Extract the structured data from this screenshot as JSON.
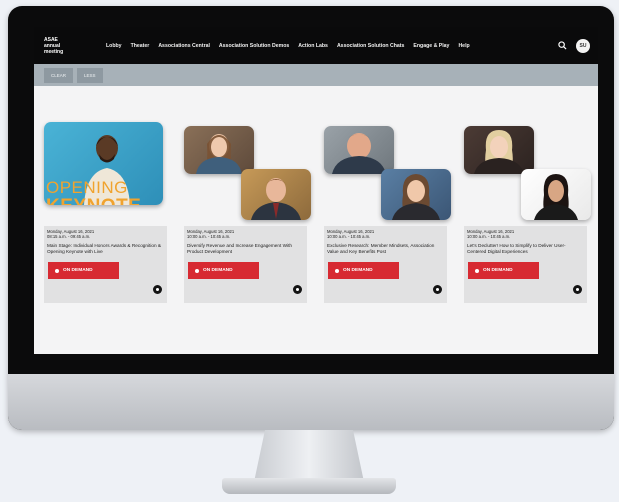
{
  "logo": {
    "line1": "ASAE",
    "line2": "annual",
    "line3": "meeting"
  },
  "nav": {
    "items": [
      {
        "label": "Lobby"
      },
      {
        "label": "Theater"
      },
      {
        "label": "Associations Central"
      },
      {
        "label": "Association Solution Demos"
      },
      {
        "label": "Action Labs"
      },
      {
        "label": "Association Solution Chats"
      },
      {
        "label": "Engage & Play"
      },
      {
        "label": "Help"
      }
    ],
    "avatar_initials": "SU"
  },
  "filters": [
    {
      "label": "CLEAR"
    },
    {
      "label": "LESS"
    }
  ],
  "keynote_text": {
    "line1": "OPENING",
    "line2": "KEYNOTE"
  },
  "cards": [
    {
      "date": "Monday, August 16, 2021",
      "time": "08:15 a.m. - 09:45 a.m.",
      "title": "Main Stage: Individual Honors Awards & Recognition & Opening Keynote with Live",
      "button": "ON DEMAND"
    },
    {
      "date": "Monday, August 16, 2021",
      "time": "10:00 a.m. - 10:45 a.m.",
      "title": "Diversify Revenue and Increase Engagement With Product Development",
      "button": "ON DEMAND"
    },
    {
      "date": "Monday, August 16, 2021",
      "time": "10:00 a.m. - 10:45 a.m.",
      "title": "Exclusive Research: Member Mindsets, Association Value and Key Benefits Post",
      "button": "ON DEMAND"
    },
    {
      "date": "Monday, August 16, 2021",
      "time": "10:00 a.m. - 10:45 a.m.",
      "title": "Let's Declutter! How to Simplify to Deliver User-Centered Digital Experiences",
      "button": "ON DEMAND"
    }
  ],
  "colors": {
    "accent_red": "#d72a32",
    "keynote_orange": "#f0a32e",
    "topbar": "#0a0a0b",
    "subbar": "#a7b1b8"
  },
  "icons": {
    "search": "search-icon",
    "info": "info-icon",
    "dot": "dot-icon"
  }
}
